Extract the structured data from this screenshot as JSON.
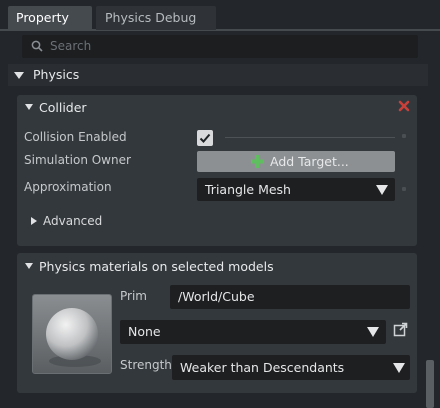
{
  "tabs": {
    "property": "Property",
    "physics_debug": "Physics Debug"
  },
  "search": {
    "placeholder": "Search"
  },
  "physics": {
    "title": "Physics",
    "collider": {
      "title": "Collider",
      "collision_enabled_label": "Collision Enabled",
      "collision_enabled": true,
      "simulation_owner_label": "Simulation Owner",
      "add_target_label": "Add Target...",
      "approximation_label": "Approximation",
      "approximation_value": "Triangle Mesh",
      "advanced_label": "Advanced"
    },
    "materials": {
      "title": "Physics materials on selected models",
      "prim_label": "Prim",
      "prim_value": "/World/Cube",
      "material_value": "None",
      "strength_label": "Strength",
      "strength_value": "Weaker than Descendants"
    }
  },
  "colors": {
    "background": "#23272b",
    "panel": "#33383c",
    "field": "#1d1f21",
    "accent_green": "#5fbe5f",
    "close_red": "#c9403a"
  }
}
